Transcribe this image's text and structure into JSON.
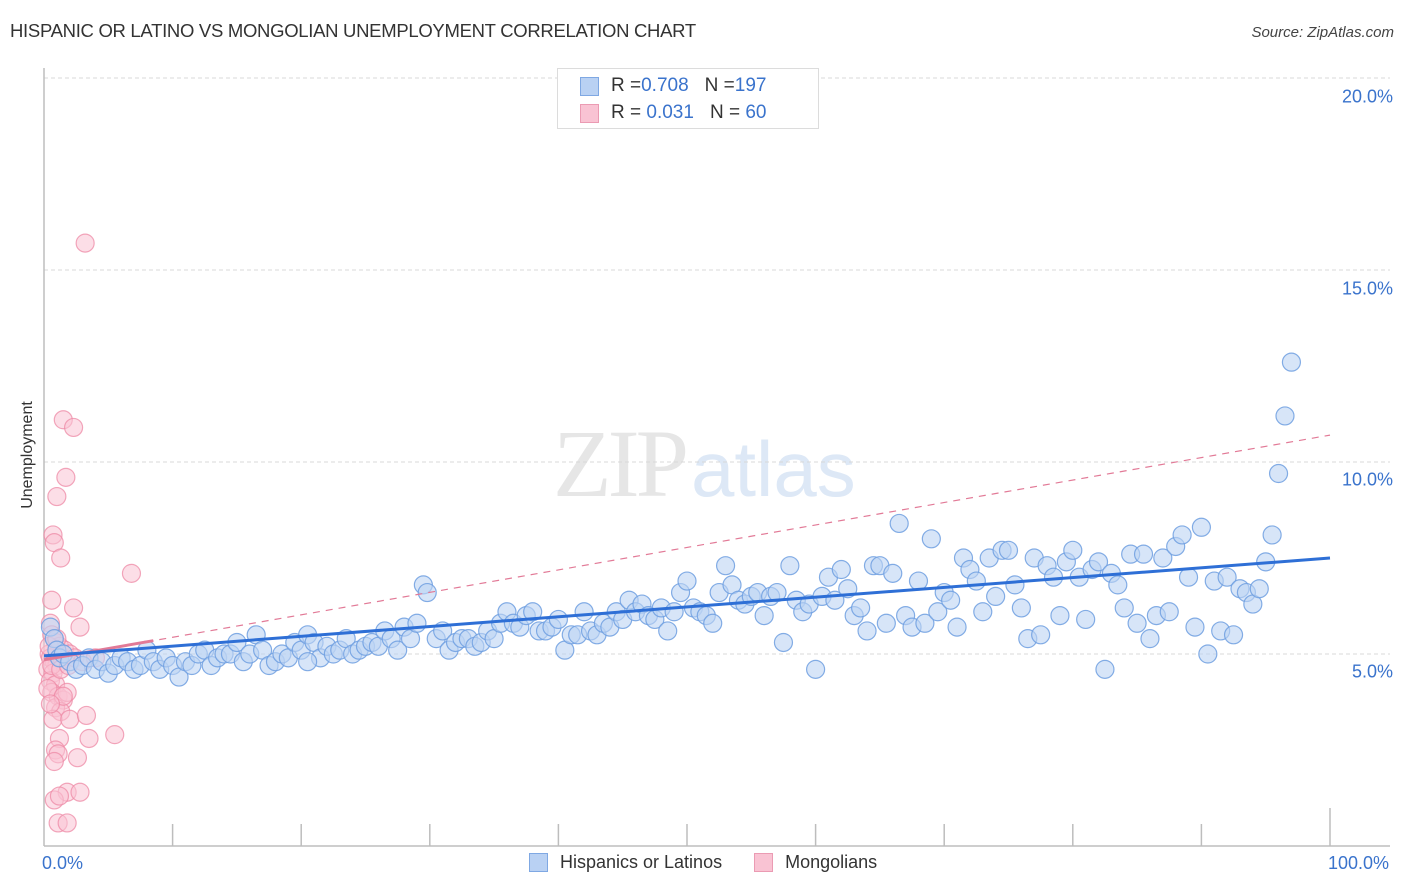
{
  "header": {
    "title": "HISPANIC OR LATINO VS MONGOLIAN UNEMPLOYMENT CORRELATION CHART",
    "source": "Source: ZipAtlas.com"
  },
  "watermark": {
    "zip": "ZIP",
    "atlas": "atlas"
  },
  "stats_legend": [
    {
      "r_label": "R = ",
      "r_value": "0.708",
      "n_label": "N = ",
      "n_value": "197",
      "color": "#b9d1f3"
    },
    {
      "r_label": "R = ",
      "r_value": " 0.031",
      "n_label": "N = ",
      "n_value": " 60",
      "color": "#f9c3d3"
    }
  ],
  "chart_data": {
    "type": "scatter",
    "title": "HISPANIC OR LATINO VS MONGOLIAN UNEMPLOYMENT CORRELATION CHART",
    "xlabel": "",
    "ylabel": "Unemployment",
    "xlim": [
      0,
      100
    ],
    "ylim": [
      0,
      20
    ],
    "x_tick_labels": [
      "0.0%",
      "100.0%"
    ],
    "y_ticks": [
      5,
      10,
      15,
      20
    ],
    "y_tick_labels": [
      "5.0%",
      "10.0%",
      "15.0%",
      "20.0%"
    ],
    "grid": true,
    "legend_position": "bottom-center",
    "series": [
      {
        "name": "Hispanics or Latinos",
        "color": "#6e9fe0",
        "fill": "#bcd3f3",
        "trend": {
          "x": [
            0,
            100
          ],
          "y": [
            4.95,
            7.5
          ],
          "style": "solid",
          "color": "#2e6fd6"
        },
        "points": [
          [
            0.5,
            5.7
          ],
          [
            0.8,
            5.4
          ],
          [
            1.0,
            5.1
          ],
          [
            1.2,
            4.9
          ],
          [
            1.5,
            5.0
          ],
          [
            2.0,
            4.8
          ],
          [
            2.5,
            4.6
          ],
          [
            3.0,
            4.7
          ],
          [
            3.5,
            4.9
          ],
          [
            4.0,
            4.6
          ],
          [
            4.5,
            4.8
          ],
          [
            5.0,
            4.5
          ],
          [
            5.5,
            4.7
          ],
          [
            6.0,
            4.9
          ],
          [
            6.5,
            4.8
          ],
          [
            7.0,
            4.6
          ],
          [
            7.5,
            4.7
          ],
          [
            8.0,
            5.1
          ],
          [
            8.5,
            4.8
          ],
          [
            9.0,
            4.6
          ],
          [
            9.5,
            4.9
          ],
          [
            10.0,
            4.7
          ],
          [
            10.5,
            4.4
          ],
          [
            11.0,
            4.8
          ],
          [
            11.5,
            4.7
          ],
          [
            12.0,
            5.0
          ],
          [
            12.5,
            5.1
          ],
          [
            13.0,
            4.7
          ],
          [
            13.5,
            4.9
          ],
          [
            14.0,
            5.0
          ],
          [
            14.5,
            5.0
          ],
          [
            15.0,
            5.3
          ],
          [
            15.5,
            4.8
          ],
          [
            16.0,
            5.0
          ],
          [
            16.5,
            5.5
          ],
          [
            17.0,
            5.1
          ],
          [
            17.5,
            4.7
          ],
          [
            18.0,
            4.8
          ],
          [
            18.5,
            5.0
          ],
          [
            19.0,
            4.9
          ],
          [
            19.5,
            5.3
          ],
          [
            20.0,
            5.1
          ],
          [
            20.5,
            5.5
          ],
          [
            21.0,
            5.3
          ],
          [
            21.5,
            4.9
          ],
          [
            22.0,
            5.2
          ],
          [
            22.5,
            5.0
          ],
          [
            23.0,
            5.1
          ],
          [
            23.5,
            5.4
          ],
          [
            24.0,
            5.0
          ],
          [
            24.5,
            5.1
          ],
          [
            25.0,
            5.2
          ],
          [
            25.5,
            5.3
          ],
          [
            26.0,
            5.2
          ],
          [
            26.5,
            5.6
          ],
          [
            27.0,
            5.4
          ],
          [
            27.5,
            5.1
          ],
          [
            28.0,
            5.7
          ],
          [
            28.5,
            5.4
          ],
          [
            29.0,
            5.8
          ],
          [
            29.5,
            6.8
          ],
          [
            29.8,
            6.6
          ],
          [
            30.5,
            5.4
          ],
          [
            31.0,
            5.6
          ],
          [
            31.5,
            5.1
          ],
          [
            32.0,
            5.3
          ],
          [
            32.5,
            5.4
          ],
          [
            33.0,
            5.4
          ],
          [
            33.5,
            5.2
          ],
          [
            34.0,
            5.3
          ],
          [
            34.5,
            5.6
          ],
          [
            35.0,
            5.4
          ],
          [
            35.5,
            5.8
          ],
          [
            36.0,
            6.1
          ],
          [
            36.5,
            5.8
          ],
          [
            37.0,
            5.7
          ],
          [
            37.5,
            6.0
          ],
          [
            38.0,
            6.1
          ],
          [
            38.5,
            5.6
          ],
          [
            39.0,
            5.6
          ],
          [
            39.5,
            5.7
          ],
          [
            40.0,
            5.9
          ],
          [
            40.5,
            5.1
          ],
          [
            41.0,
            5.5
          ],
          [
            41.5,
            5.5
          ],
          [
            42.0,
            6.1
          ],
          [
            42.5,
            5.6
          ],
          [
            43.0,
            5.5
          ],
          [
            43.5,
            5.8
          ],
          [
            44.0,
            5.7
          ],
          [
            44.5,
            6.1
          ],
          [
            45.0,
            5.9
          ],
          [
            45.5,
            6.4
          ],
          [
            46.0,
            6.1
          ],
          [
            46.5,
            6.3
          ],
          [
            47.0,
            6.0
          ],
          [
            47.5,
            5.9
          ],
          [
            48.0,
            6.2
          ],
          [
            48.5,
            5.6
          ],
          [
            49.0,
            6.1
          ],
          [
            49.5,
            6.6
          ],
          [
            50.0,
            6.9
          ],
          [
            50.5,
            6.2
          ],
          [
            51.0,
            6.1
          ],
          [
            51.5,
            6.0
          ],
          [
            52.0,
            5.8
          ],
          [
            52.5,
            6.6
          ],
          [
            53.0,
            7.3
          ],
          [
            53.5,
            6.8
          ],
          [
            54.0,
            6.4
          ],
          [
            54.5,
            6.3
          ],
          [
            55.0,
            6.5
          ],
          [
            55.5,
            6.6
          ],
          [
            56.0,
            6.0
          ],
          [
            56.5,
            6.5
          ],
          [
            57.0,
            6.6
          ],
          [
            57.5,
            5.3
          ],
          [
            58.0,
            7.3
          ],
          [
            58.5,
            6.4
          ],
          [
            59.0,
            6.1
          ],
          [
            59.5,
            6.3
          ],
          [
            60.0,
            4.6
          ],
          [
            60.5,
            6.5
          ],
          [
            61.0,
            7.0
          ],
          [
            61.5,
            6.4
          ],
          [
            62.0,
            7.2
          ],
          [
            62.5,
            6.7
          ],
          [
            63.0,
            6.0
          ],
          [
            63.5,
            6.2
          ],
          [
            64.0,
            5.6
          ],
          [
            64.5,
            7.3
          ],
          [
            65.0,
            7.3
          ],
          [
            65.5,
            5.8
          ],
          [
            66.0,
            7.1
          ],
          [
            66.5,
            8.4
          ],
          [
            67.0,
            6.0
          ],
          [
            67.5,
            5.7
          ],
          [
            68.0,
            6.9
          ],
          [
            68.5,
            5.8
          ],
          [
            69.0,
            8.0
          ],
          [
            69.5,
            6.1
          ],
          [
            70.0,
            6.6
          ],
          [
            70.5,
            6.4
          ],
          [
            71.0,
            5.7
          ],
          [
            71.5,
            7.5
          ],
          [
            72.0,
            7.2
          ],
          [
            72.5,
            6.9
          ],
          [
            73.0,
            6.1
          ],
          [
            73.5,
            7.5
          ],
          [
            74.0,
            6.5
          ],
          [
            74.5,
            7.7
          ],
          [
            75.0,
            7.7
          ],
          [
            75.5,
            6.8
          ],
          [
            76.0,
            6.2
          ],
          [
            76.5,
            5.4
          ],
          [
            77.0,
            7.5
          ],
          [
            77.5,
            5.5
          ],
          [
            78.0,
            7.3
          ],
          [
            78.5,
            7.0
          ],
          [
            79.0,
            6.0
          ],
          [
            79.5,
            7.4
          ],
          [
            80.0,
            7.7
          ],
          [
            80.5,
            7.0
          ],
          [
            81.0,
            5.9
          ],
          [
            81.5,
            7.2
          ],
          [
            82.0,
            7.4
          ],
          [
            82.5,
            4.6
          ],
          [
            83.0,
            7.1
          ],
          [
            83.5,
            6.8
          ],
          [
            84.0,
            6.2
          ],
          [
            84.5,
            7.6
          ],
          [
            85.0,
            5.8
          ],
          [
            85.5,
            7.6
          ],
          [
            86.0,
            5.4
          ],
          [
            86.5,
            6.0
          ],
          [
            87.0,
            7.5
          ],
          [
            87.5,
            6.1
          ],
          [
            88.0,
            7.8
          ],
          [
            88.5,
            8.1
          ],
          [
            89.0,
            7.0
          ],
          [
            89.5,
            5.7
          ],
          [
            90.0,
            8.3
          ],
          [
            90.5,
            5.0
          ],
          [
            91.0,
            6.9
          ],
          [
            91.5,
            5.6
          ],
          [
            92.0,
            7.0
          ],
          [
            92.5,
            5.5
          ],
          [
            93.0,
            6.7
          ],
          [
            93.5,
            6.6
          ],
          [
            94.0,
            6.3
          ],
          [
            94.5,
            6.7
          ],
          [
            95.0,
            7.4
          ],
          [
            95.5,
            8.1
          ],
          [
            96.0,
            9.7
          ],
          [
            96.5,
            11.2
          ],
          [
            97.0,
            12.6
          ],
          [
            20.5,
            4.8
          ]
        ]
      },
      {
        "name": "Mongolians",
        "color": "#ee8aa6",
        "fill": "#f9c3d3",
        "trend": {
          "x": [
            0,
            100
          ],
          "y": [
            4.85,
            10.7
          ],
          "style": "dashed",
          "color": "#e27a97",
          "solid_segment_x": [
            0,
            8.5
          ]
        },
        "points": [
          [
            3.2,
            15.7
          ],
          [
            1.5,
            11.1
          ],
          [
            2.3,
            10.9
          ],
          [
            1.7,
            9.6
          ],
          [
            1.0,
            9.1
          ],
          [
            0.7,
            8.1
          ],
          [
            0.8,
            7.9
          ],
          [
            1.3,
            7.5
          ],
          [
            6.8,
            7.1
          ],
          [
            0.6,
            6.4
          ],
          [
            2.3,
            6.2
          ],
          [
            2.8,
            5.7
          ],
          [
            0.5,
            5.8
          ],
          [
            0.6,
            5.5
          ],
          [
            0.9,
            5.3
          ],
          [
            1.2,
            5.2
          ],
          [
            1.6,
            5.1
          ],
          [
            0.4,
            5.0
          ],
          [
            0.5,
            4.9
          ],
          [
            0.8,
            4.8
          ],
          [
            1.0,
            4.7
          ],
          [
            0.3,
            4.6
          ],
          [
            0.7,
            4.5
          ],
          [
            1.4,
            4.9
          ],
          [
            2.0,
            5.0
          ],
          [
            0.5,
            4.3
          ],
          [
            0.9,
            4.2
          ],
          [
            0.6,
            4.0
          ],
          [
            1.1,
            3.9
          ],
          [
            1.5,
            3.8
          ],
          [
            0.9,
            3.6
          ],
          [
            1.3,
            3.5
          ],
          [
            1.8,
            4.0
          ],
          [
            0.7,
            3.3
          ],
          [
            2.0,
            3.3
          ],
          [
            3.3,
            3.4
          ],
          [
            1.2,
            2.8
          ],
          [
            3.5,
            2.8
          ],
          [
            0.9,
            2.5
          ],
          [
            1.1,
            2.4
          ],
          [
            2.6,
            2.3
          ],
          [
            0.8,
            2.2
          ],
          [
            1.8,
            1.4
          ],
          [
            0.8,
            1.2
          ],
          [
            1.2,
            1.3
          ],
          [
            2.8,
            1.4
          ],
          [
            1.1,
            0.6
          ],
          [
            1.8,
            0.6
          ],
          [
            0.4,
            5.2
          ],
          [
            0.6,
            4.7
          ],
          [
            1.0,
            5.4
          ],
          [
            1.3,
            4.6
          ],
          [
            1.9,
            4.7
          ],
          [
            2.4,
            4.9
          ],
          [
            3.0,
            4.8
          ],
          [
            4.0,
            4.9
          ],
          [
            0.3,
            4.1
          ],
          [
            5.5,
            2.9
          ],
          [
            1.5,
            3.9
          ],
          [
            0.5,
            3.7
          ]
        ]
      }
    ]
  },
  "axis": {
    "x_min_label": "0.0%",
    "x_max_label": "100.0%"
  },
  "bottom_legend": [
    {
      "label": "Hispanics or Latinos",
      "color": "#b9d1f3",
      "border": "#7fa8e3"
    },
    {
      "label": "Mongolians",
      "color": "#f9c3d3",
      "border": "#eb9bb3"
    }
  ]
}
